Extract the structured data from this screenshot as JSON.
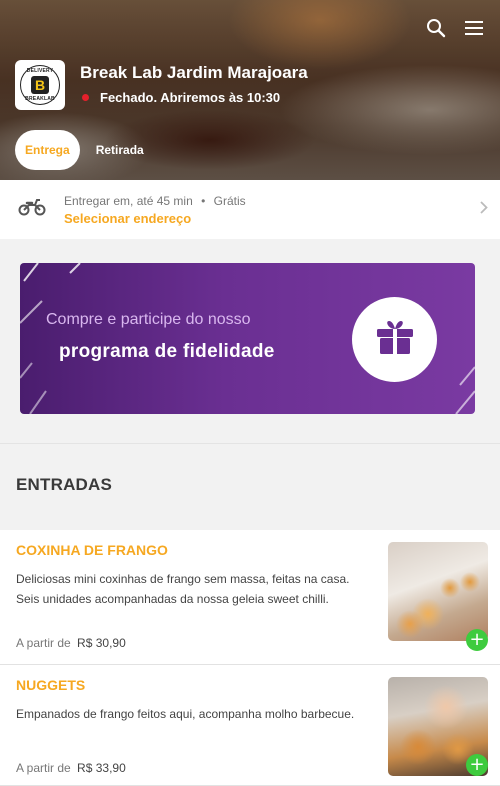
{
  "header": {
    "store_name": "Break Lab Jardim Marajoara",
    "status_text": "Fechado. Abriremos às 10:30",
    "logo_text_top": "DELIVERY",
    "logo_text_bottom": "BREAKLAB",
    "logo_letter": "B",
    "tabs": [
      {
        "label": "Entrega",
        "active": true
      },
      {
        "label": "Retirada",
        "active": false
      }
    ]
  },
  "delivery": {
    "prefix": "Entregar em,",
    "eta": "até 45 min",
    "separator": "•",
    "fee": "Grátis",
    "action": "Selecionar endereço"
  },
  "promo": {
    "line1": "Compre e participe do nosso",
    "line2": "programa de fidelidade"
  },
  "section": {
    "title": "ENTRADAS"
  },
  "items": [
    {
      "name": "COXINHA DE FRANGO",
      "description": "Deliciosas mini coxinhas de frango sem massa, feitas na casa. Seis unidades acompanhadas da nossa geleia sweet chilli.",
      "price_prefix": "A partir de",
      "price": "R$ 30,90",
      "add": "+"
    },
    {
      "name": "NUGGETS",
      "description": "Empanados de frango feitos aqui, acompanha molho barbecue.",
      "price_prefix": "A partir de",
      "price": "R$ 33,90",
      "add": "+"
    }
  ],
  "colors": {
    "accent": "#f6a821",
    "status_closed": "#e5202b",
    "add_button": "#3ecb3e",
    "promo_bg": "#6a2f92"
  },
  "icons": [
    "search-icon",
    "menu-icon",
    "motorcycle-icon",
    "chevron-right-icon",
    "gift-icon",
    "plus-icon"
  ]
}
